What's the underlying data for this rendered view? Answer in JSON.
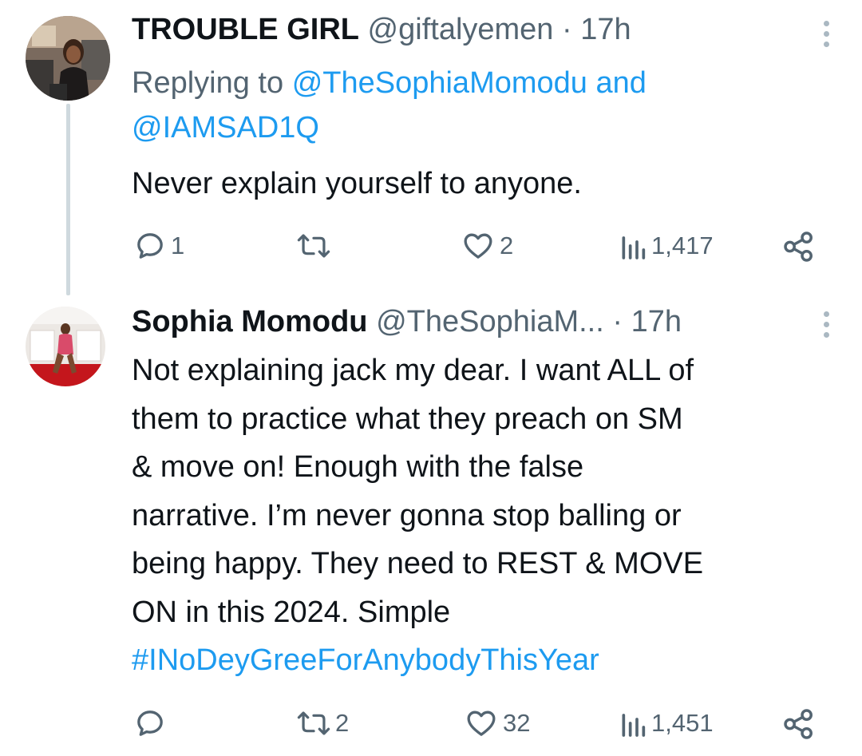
{
  "tweets": [
    {
      "display_name": "TROUBLE GIRL",
      "handle": "@giftalyemen",
      "separator": "·",
      "time": "17h",
      "replying_prefix": "Replying to",
      "reply_mention_1": "@TheSophiaMomodu",
      "reply_and": "and",
      "reply_mention_2": "@IAMSAD1Q",
      "text": "Never explain yourself to anyone.",
      "replies": "1",
      "retweets": "",
      "likes": "2",
      "views": "1,417",
      "icons": {
        "reply": "reply-icon",
        "retweet": "retweet-icon",
        "like": "heart-icon",
        "views": "views-chart-icon",
        "share": "share-icon",
        "more": "more-vertical-icon"
      }
    },
    {
      "display_name": "Sophia Momodu",
      "handle": "@TheSophiaM...",
      "separator": "·",
      "time": "17h",
      "text_lines": [
        "Not explaining jack my dear. I want ALL of",
        "them to practice what they preach on SM",
        "& move on! Enough with the false",
        "narrative. I’m never gonna stop balling or",
        "being happy. They need to REST & MOVE",
        "ON in this 2024. Simple"
      ],
      "hashtag": "#INoDeyGreeForAnybodyThisYear",
      "replies": "",
      "retweets": "2",
      "likes": "32",
      "views": "1,451",
      "icons": {
        "reply": "reply-icon",
        "retweet": "retweet-icon",
        "like": "heart-icon",
        "views": "views-chart-icon",
        "share": "share-icon",
        "more": "more-vertical-icon"
      }
    }
  ],
  "colors": {
    "link": "#1d9bf0",
    "muted": "#536471",
    "text": "#0f1419",
    "thread_line": "#cfd9de"
  }
}
